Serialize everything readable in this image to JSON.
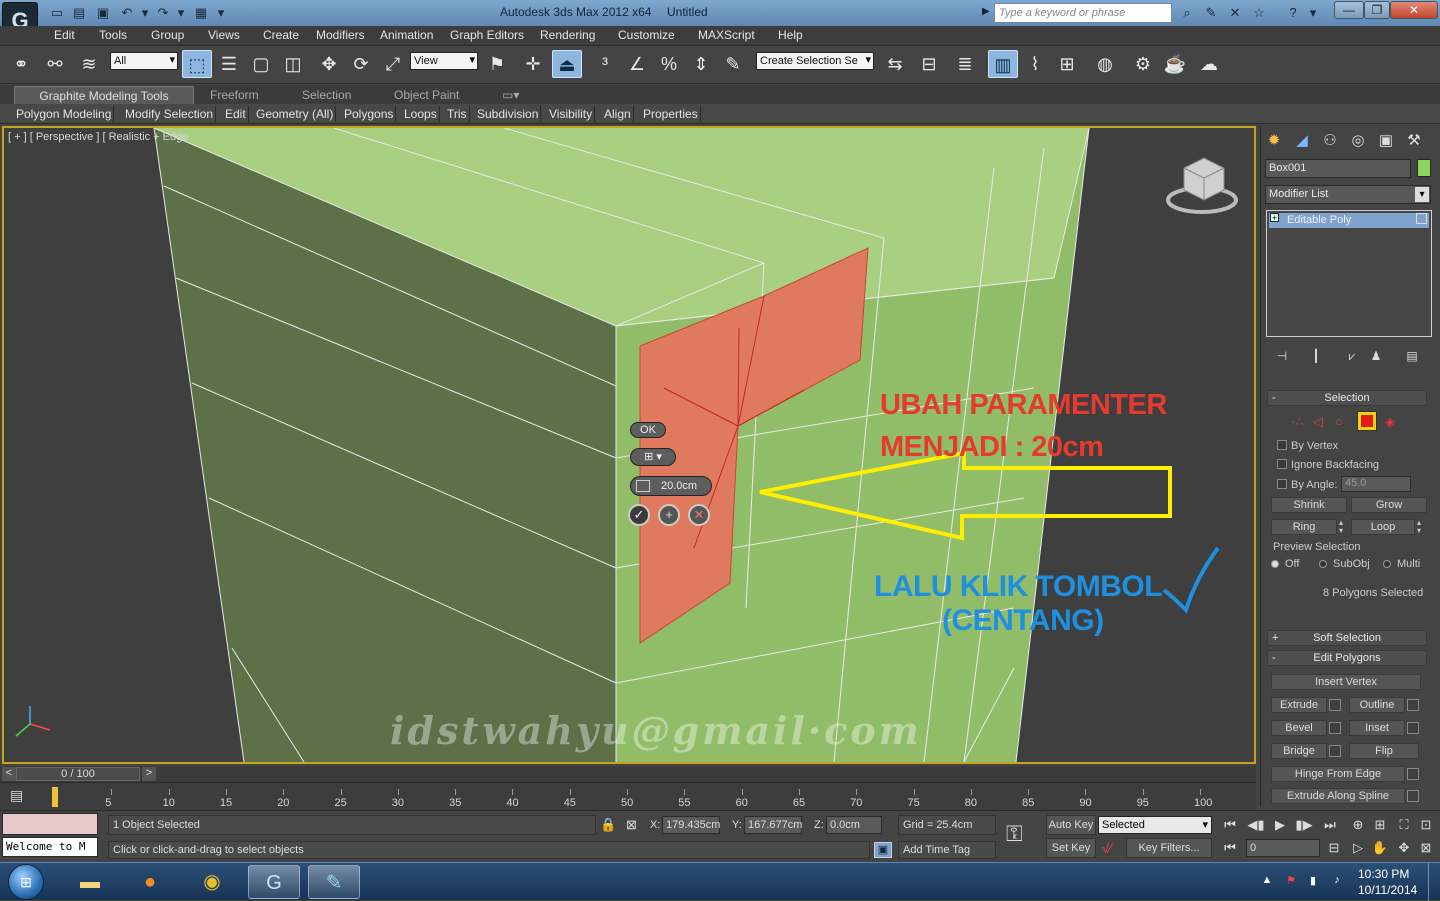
{
  "titlebar": {
    "app_logo": "G",
    "title": "Autodesk 3ds Max  2012 x64",
    "file": "Untitled",
    "search_placeholder": "Type a keyword or phrase"
  },
  "menu": [
    "Edit",
    "Tools",
    "Group",
    "Views",
    "Create",
    "Modifiers",
    "Animation",
    "Graph Editors",
    "Rendering",
    "Customize",
    "MAXScript",
    "Help"
  ],
  "toolbar": {
    "selection_filter": "All",
    "ref_coord": "View",
    "named_selection": "Create Selection Se"
  },
  "ribbon": {
    "tabs": [
      "Graphite Modeling Tools",
      "Freeform",
      "Selection",
      "Object Paint"
    ],
    "panels": [
      "Polygon Modeling",
      "Modify Selection",
      "Edit",
      "Geometry (All)",
      "Polygons",
      "Loops",
      "Tris",
      "Subdivision",
      "Visibility",
      "Align",
      "Properties"
    ]
  },
  "viewport": {
    "label": "[ + ] [ Perspective ] [ Realistic + Edge",
    "caddy_ok": "OK",
    "caddy_value": "20.0cm",
    "annotation_red_line1": "UBAH PARAMENTER",
    "annotation_red_line2": "MENJADI : 20cm",
    "annotation_blue": "LALU KLIK TOMBOL",
    "annotation_blue_suffix": "(CENTANG)",
    "watermark": "idstwahyu@gmail·com",
    "accent_selection": "#e07a5f",
    "accent_box": "#9cc46e",
    "arrow_color": "#ffee00"
  },
  "command_panel": {
    "object_name": "Box001",
    "object_color": "#8cd65e",
    "modifier_list": "Modifier List",
    "stack_item": "Editable Poly",
    "selection": {
      "title": "Selection",
      "by_vertex": "By Vertex",
      "ignore_backfacing": "Ignore Backfacing",
      "by_angle": "By Angle:",
      "angle_value": "45.0",
      "shrink": "Shrink",
      "grow": "Grow",
      "ring": "Ring",
      "loop": "Loop",
      "preview_selection": "Preview Selection",
      "off": "Off",
      "subobj": "SubObj",
      "multi": "Multi",
      "status": "8 Polygons Selected"
    },
    "soft_selection": "Soft Selection",
    "edit_polygons": {
      "title": "Edit Polygons",
      "insert_vertex": "Insert Vertex",
      "extrude": "Extrude",
      "outline": "Outline",
      "bevel": "Bevel",
      "inset": "Inset",
      "bridge": "Bridge",
      "flip": "Flip",
      "hinge": "Hinge From Edge",
      "extrude_spline": "Extrude Along Spline"
    }
  },
  "timeline": {
    "frame": "0 / 100",
    "ticks": [
      "5",
      "10",
      "15",
      "20",
      "25",
      "30",
      "35",
      "40",
      "45",
      "50",
      "55",
      "60",
      "65",
      "70",
      "75",
      "80",
      "85",
      "90",
      "95",
      "100"
    ]
  },
  "status": {
    "welcome": "Welcome to M",
    "selected": "1 Object Selected",
    "prompt": "Click or click-and-drag to select objects",
    "x_label": "X:",
    "x": "179.435cm",
    "y_label": "Y:",
    "y": "167.677cm",
    "z_label": "Z:",
    "z": "0.0cm",
    "grid": "Grid = 25.4cm",
    "add_time_tag": "Add Time Tag",
    "auto_key": "Auto Key",
    "set_key": "Set Key",
    "selected_dropdown": "Selected",
    "key_filters": "Key Filters...",
    "frame_field": "0"
  },
  "taskbar": {
    "time": "10:30 PM",
    "date": "10/11/2014"
  }
}
